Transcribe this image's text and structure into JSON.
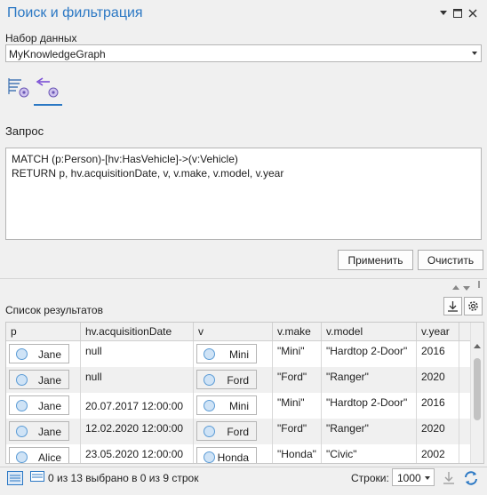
{
  "panel": {
    "title": "Поиск и фильтрация"
  },
  "dataset": {
    "label": "Набор данных",
    "value": "MyKnowledgeGraph"
  },
  "query": {
    "title": "Запрос",
    "text": "MATCH (p:Person)-[hv:HasVehicle]->(v:Vehicle)\nRETURN p, hv.acquisitionDate, v, v.make, v.model, v.year"
  },
  "buttons": {
    "apply": "Применить",
    "clear": "Очистить"
  },
  "results": {
    "label": "Список результатов",
    "columns": [
      "p",
      "hv.acquisitionDate",
      "v",
      "v.make",
      "v.model",
      "v.year"
    ],
    "rows": [
      {
        "p": "Jane",
        "date": "null",
        "v": "Mini",
        "make": "\"Mini\"",
        "model": "\"Hardtop 2-Door\"",
        "year": "2016"
      },
      {
        "p": "Jane",
        "date": "null",
        "v": "Ford",
        "make": "\"Ford\"",
        "model": "\"Ranger\"",
        "year": "2020"
      },
      {
        "p": "Jane",
        "date": "20.07.2017 12:00:00",
        "v": "Mini",
        "make": "\"Mini\"",
        "model": "\"Hardtop 2-Door\"",
        "year": "2016"
      },
      {
        "p": "Jane",
        "date": "12.02.2020 12:00:00",
        "v": "Ford",
        "make": "\"Ford\"",
        "model": "\"Ranger\"",
        "year": "2020"
      },
      {
        "p": "Alice",
        "date": "23.05.2020 12:00:00",
        "v": "Honda",
        "make": "\"Honda\"",
        "model": "\"Civic\"",
        "year": "2002"
      }
    ]
  },
  "status": {
    "selection_text": "0 из 13 выбрано в 0 из 9 строк",
    "rows_label": "Строки:",
    "rows_value": "1000"
  },
  "icons": [
    "menu-icon",
    "pin-icon",
    "maximize-icon",
    "close-icon",
    "query-builder-icon",
    "cypher-query-icon",
    "export-icon",
    "settings-icon",
    "scroll-up-icon",
    "scroll-down-icon",
    "table-view-icon",
    "list-view-icon",
    "download-icon",
    "refresh-icon"
  ],
  "colors": {
    "accent": "#2b78c4",
    "panel_bg": "#f0f0f0",
    "node_fill": "#cfe3f6",
    "node_stroke": "#5b9bd5"
  }
}
